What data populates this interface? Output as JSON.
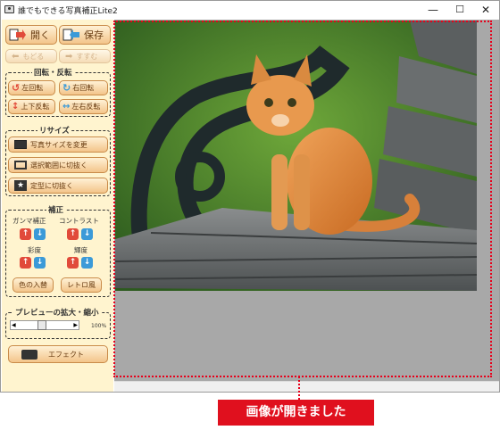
{
  "window": {
    "title": "誰でもできる写真補正Lite2",
    "minimize": "—",
    "maximize": "☐",
    "close": "✕"
  },
  "toolbar": {
    "open_label": "開く",
    "save_label": "保存",
    "undo_label": "もどる",
    "redo_label": "すすむ"
  },
  "rotate": {
    "title": "回転・反転",
    "left_label": "左回転",
    "right_label": "右回転",
    "flip_v_label": "上下反転",
    "flip_h_label": "左右反転"
  },
  "resize": {
    "title": "リサイズ",
    "change_size_label": "写真サイズを変更",
    "crop_selection_label": "選択範囲に切抜く",
    "crop_fixed_label": "定型に切抜く"
  },
  "correction": {
    "title": "補正",
    "gamma_label": "ガンマ補正",
    "contrast_label": "コントラスト",
    "saturation_label": "彩度",
    "brightness_label": "輝度",
    "color_swap_label": "色の入替",
    "retro_label": "レトロ風",
    "up_glyph": "↑",
    "down_glyph": "↓"
  },
  "preview": {
    "title": "プレビューの拡大・縮小",
    "zoom_text": "100%",
    "zoom_value": 100
  },
  "effect": {
    "label": "エフェクト"
  },
  "callout": {
    "text": "画像が開きました"
  },
  "colors": {
    "accent_red": "#e0101e",
    "button_border": "#c98b49",
    "sidebar_bg": "#fff4cf"
  }
}
